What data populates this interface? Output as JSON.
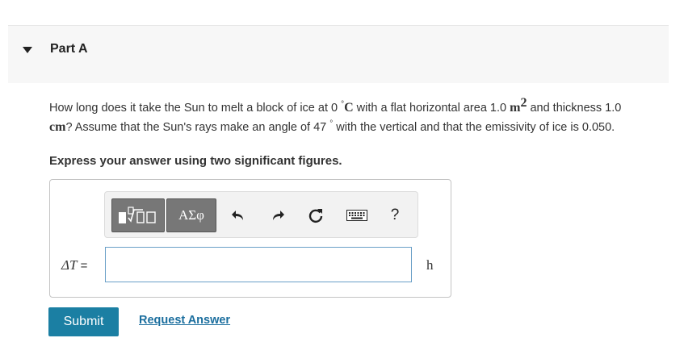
{
  "part": {
    "title": "Part A"
  },
  "question": {
    "t1": "How long does it take the Sun to melt a block of ice at 0 ",
    "deg": "°",
    "c_unit": "C",
    "t2": " with a flat horizontal area 1.0 ",
    "area_unit": "m",
    "area_exp": "2",
    "t3": " and thickness 1.0 ",
    "len_unit": "cm",
    "t4": "? Assume that the Sun's rays make an angle of 47 ",
    "deg2": "°",
    "t5": " with the vertical and that the emissivity of ice is 0.050."
  },
  "instruction": "Express your answer using two significant figures.",
  "toolbar": {
    "greek_label": "ΑΣφ",
    "help_label": "?"
  },
  "answer": {
    "label": "ΔT",
    "equals": " =",
    "value": "",
    "unit": "h"
  },
  "actions": {
    "submit_label": "Submit",
    "request_label": "Request Answer"
  },
  "colors": {
    "submit_bg": "#1b7fa3",
    "link": "#1b6e9e",
    "header_bg": "#f7f7f7"
  }
}
